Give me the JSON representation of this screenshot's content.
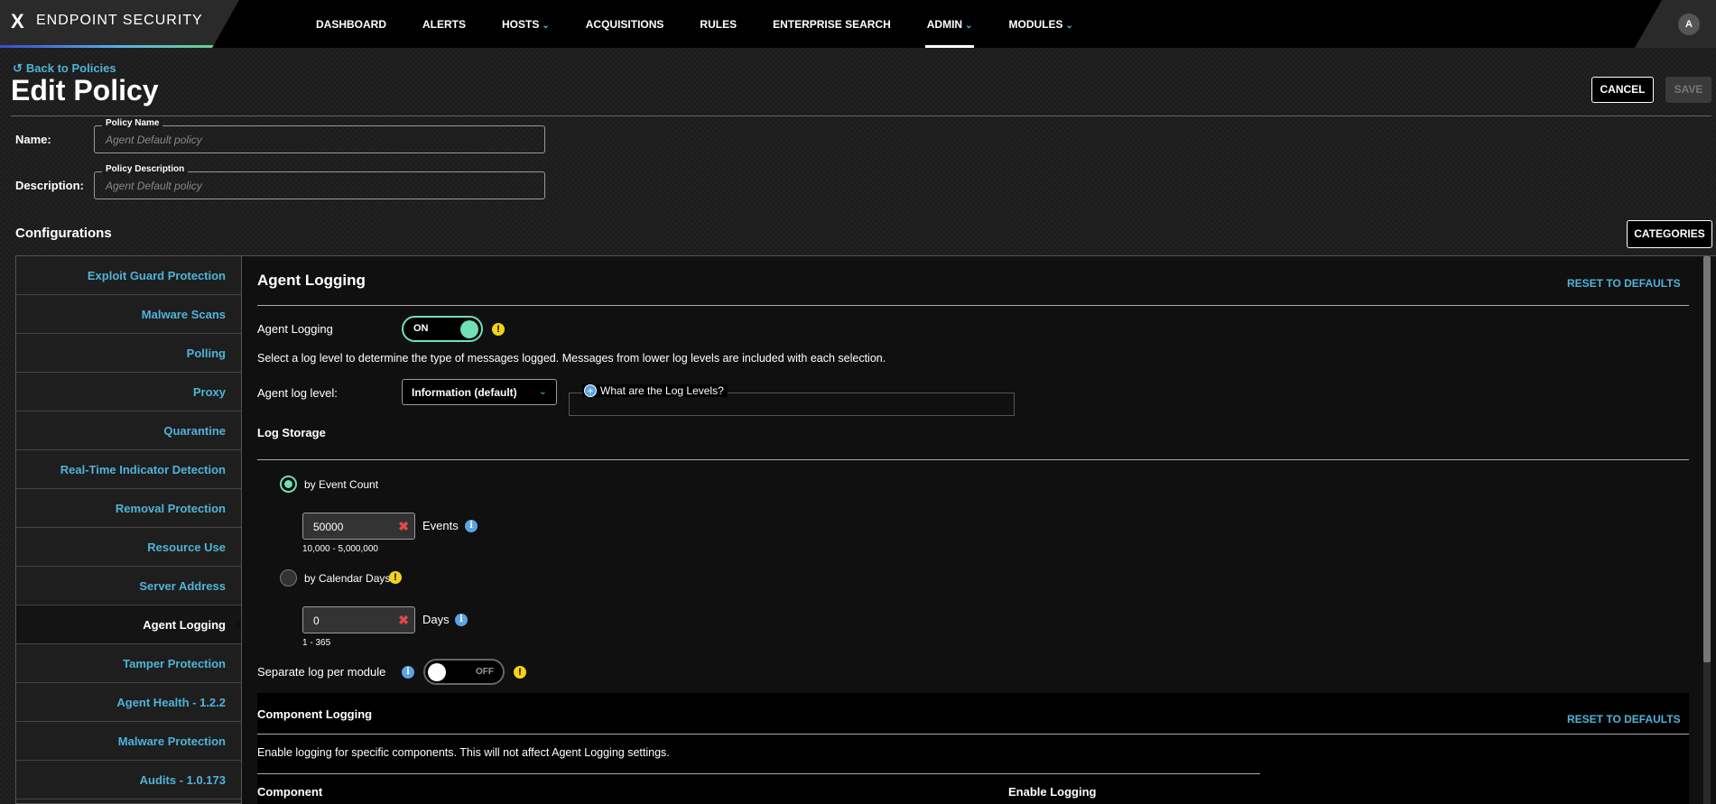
{
  "app": {
    "logo_glyph": "X",
    "name": "ENDPOINT SECURITY",
    "user_initial": "A"
  },
  "nav": {
    "items": [
      {
        "label": "DASHBOARD",
        "chevron": ""
      },
      {
        "label": "ALERTS",
        "chevron": ""
      },
      {
        "label": "HOSTS",
        "chevron": "⌄"
      },
      {
        "label": "ACQUISITIONS",
        "chevron": ""
      },
      {
        "label": "RULES",
        "chevron": ""
      },
      {
        "label": "ENTERPRISE SEARCH",
        "chevron": ""
      },
      {
        "label": "ADMIN",
        "chevron": "⌄"
      },
      {
        "label": "MODULES",
        "chevron": "⌄"
      }
    ]
  },
  "header": {
    "back_label": "Back to Policies",
    "back_icon": "↺",
    "title": "Edit Policy",
    "cancel_label": "CANCEL",
    "save_label": "SAVE"
  },
  "form": {
    "name_label": "Name:",
    "name_legend": "Policy Name",
    "name_placeholder": "Agent Default policy",
    "desc_label": "Description:",
    "desc_legend": "Policy Description",
    "desc_placeholder": "Agent Default policy"
  },
  "configurations": {
    "title": "Configurations",
    "categories_label": "CATEGORIES"
  },
  "sidebar": {
    "items": [
      "Exploit Guard Protection",
      "Malware Scans",
      "Polling",
      "Proxy",
      "Quarantine",
      "Real-Time Indicator Detection",
      "Removal Protection",
      "Resource Use",
      "Server Address",
      "Agent Logging",
      "Tamper Protection",
      "Agent Health - 1.2.2",
      "Malware Protection",
      "Audits - 1.0.173"
    ],
    "active": "Agent Logging"
  },
  "main": {
    "title": "Agent Logging",
    "reset_label": "RESET TO DEFAULTS",
    "logging_label": "Agent Logging",
    "toggle_on": "ON",
    "warn_glyph": "!",
    "info_glyph": "i",
    "description": "Select a log level to determine the type of messages logged. Messages from lower log levels are included with each selection.",
    "log_level_label": "Agent log level:",
    "log_level_value": "Information (default)",
    "dropdown_chevron": "⌄",
    "help_plus": "+",
    "help_link": "What are the Log Levels?",
    "storage_title": "Log Storage",
    "by_event_label": "by Event Count",
    "events_value": "50000",
    "clear_glyph": "✖",
    "events_unit": "Events",
    "events_range": "10,000 - 5,000,000",
    "by_days_label": "by Calendar Days",
    "days_value": "0",
    "days_unit": "Days",
    "days_range": "1 - 365",
    "separate_label": "Separate log per module",
    "toggle_off": "OFF"
  },
  "component": {
    "title": "Component Logging",
    "reset_label": "RESET TO DEFAULTS",
    "description": "Enable logging for specific components. This will not affect Agent Logging settings.",
    "col_component": "Component",
    "col_enable": "Enable Logging"
  }
}
